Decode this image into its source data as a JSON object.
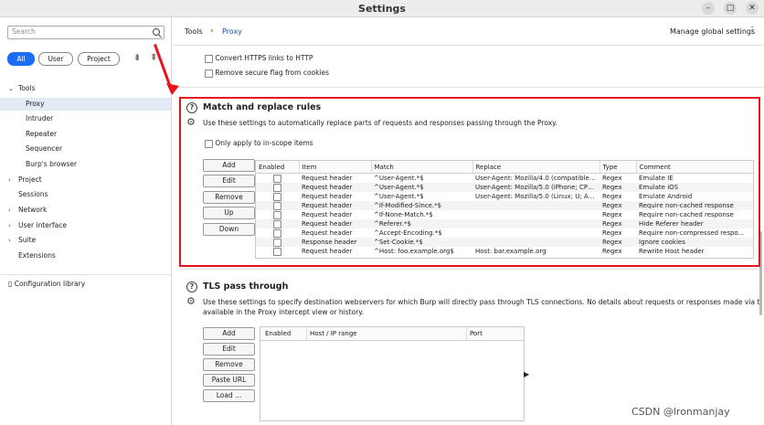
{
  "window": {
    "title": "Settings",
    "minimize": "–",
    "maximize": "□",
    "close": "✕"
  },
  "sidebar": {
    "search_placeholder": "Search",
    "filters": [
      "All",
      "User",
      "Project"
    ],
    "tree": [
      {
        "label": "Tools",
        "arrow": "⌄",
        "level": 0
      },
      {
        "label": "Proxy",
        "arrow": "",
        "level": 1,
        "selected": true
      },
      {
        "label": "Intruder",
        "arrow": "",
        "level": 1
      },
      {
        "label": "Repeater",
        "arrow": "",
        "level": 1
      },
      {
        "label": "Sequencer",
        "arrow": "",
        "level": 1
      },
      {
        "label": "Burp's browser",
        "arrow": "",
        "level": 1
      },
      {
        "label": "Project",
        "arrow": "›",
        "level": 0
      },
      {
        "label": "Sessions",
        "arrow": "",
        "level": 0
      },
      {
        "label": "Network",
        "arrow": "›",
        "level": 0
      },
      {
        "label": "User interface",
        "arrow": "›",
        "level": 0
      },
      {
        "label": "Suite",
        "arrow": "›",
        "level": 0
      },
      {
        "label": "Extensions",
        "arrow": "",
        "level": 0
      }
    ],
    "config_library": "Configuration library"
  },
  "header": {
    "breadcrumb_root": "Tools",
    "breadcrumb_sep": "›",
    "breadcrumb_current": "Proxy",
    "manage_global": "Manage global settings",
    "menu_glyph": "⋮"
  },
  "prev_options": [
    "Convert HTTPS links to HTTP",
    "Remove secure flag from cookies"
  ],
  "match_replace": {
    "title": "Match and replace rules",
    "description": "Use these settings to automatically replace parts of requests and responses passing through the Proxy.",
    "in_scope_label": "Only apply to in-scope items",
    "buttons": [
      "Add",
      "Edit",
      "Remove",
      "Up",
      "Down"
    ],
    "columns": [
      "Enabled",
      "Item",
      "Match",
      "Replace",
      "Type",
      "Comment"
    ],
    "rows": [
      [
        "",
        "Request header",
        "^User-Agent.*$",
        "User-Agent: Mozilla/4.0 (compatible; ...",
        "Regex",
        "Emulate IE"
      ],
      [
        "",
        "Request header",
        "^User-Agent.*$",
        "User-Agent: Mozilla/5.0 (iPhone; CPU...",
        "Regex",
        "Emulate iOS"
      ],
      [
        "",
        "Request header",
        "^User-Agent.*$",
        "User-Agent: Mozilla/5.0 (Linux; U; An...",
        "Regex",
        "Emulate Android"
      ],
      [
        "",
        "Request header",
        "^If-Modified-Since.*$",
        "",
        "Regex",
        "Require non-cached response"
      ],
      [
        "",
        "Request header",
        "^If-None-Match.*$",
        "",
        "Regex",
        "Require non-cached response"
      ],
      [
        "",
        "Request header",
        "^Referer.*$",
        "",
        "Regex",
        "Hide Referer header"
      ],
      [
        "",
        "Request header",
        "^Accept-Encoding.*$",
        "",
        "Regex",
        "Require non-compressed respo..."
      ],
      [
        "",
        "Response header",
        "^Set-Cookie.*$",
        "",
        "Regex",
        "Ignore cookies"
      ],
      [
        "",
        "Request header",
        "^Host: foo.example.org$",
        "Host: bar.example.org",
        "Regex",
        "Rewrite Host header"
      ]
    ]
  },
  "tls": {
    "title": "TLS pass through",
    "description_line1": "Use these settings to specify destination webservers for which Burp will directly pass through TLS connections. No details about requests or responses made via these conn",
    "description_line2": "available in the Proxy intercept view or history.",
    "buttons": [
      "Add",
      "Edit",
      "Remove",
      "Paste URL",
      "Load ..."
    ],
    "columns": [
      "Enabled",
      "Host / IP range",
      "Port"
    ]
  },
  "watermark": "CSDN @lronmanjay",
  "colors": {
    "accent": "#1a6ef5",
    "highlight": "#e8141c",
    "selected_bg": "#e3ebf6"
  }
}
